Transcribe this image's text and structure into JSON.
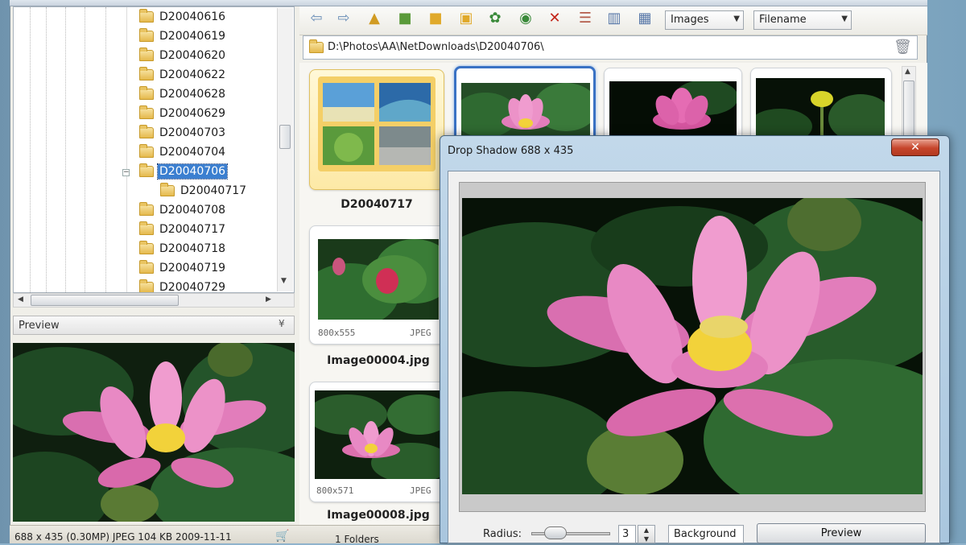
{
  "tree": {
    "items": [
      {
        "label": "D20040616"
      },
      {
        "label": "D20040619"
      },
      {
        "label": "D20040620"
      },
      {
        "label": "D20040622"
      },
      {
        "label": "D20040628"
      },
      {
        "label": "D20040629"
      },
      {
        "label": "D20040703"
      },
      {
        "label": "D20040704"
      },
      {
        "label": "D20040706",
        "selected": true
      },
      {
        "label": "D20040717",
        "child": true
      },
      {
        "label": "D20040708"
      },
      {
        "label": "D20040717"
      },
      {
        "label": "D20040718"
      },
      {
        "label": "D20040719"
      },
      {
        "label": "D20040729"
      }
    ]
  },
  "preview": {
    "title": "Preview"
  },
  "toolbar": {
    "filter_label": "Images",
    "sort_label": "Filename",
    "icons": [
      "back-arrow-icon",
      "forward-arrow-icon",
      "folder-up-icon",
      "folder-green-icon",
      "new-folder-icon",
      "open-folder-icon",
      "rotate-icon",
      "globe-refresh-icon",
      "delete-icon",
      "view-details-icon",
      "view-list-icon",
      "view-thumbnails-icon"
    ]
  },
  "address": {
    "path": "D:\\Photos\\AA\\NetDownloads\\D20040706\\"
  },
  "thumbnails": [
    {
      "caption": "D20040717",
      "kind": "folder"
    },
    {
      "caption": "",
      "kind": "image",
      "selected": true
    },
    {
      "caption": "",
      "kind": "image"
    },
    {
      "caption": "",
      "kind": "image"
    },
    {
      "caption": "Image00004.jpg",
      "dims": "800x555",
      "format": "JPEG"
    },
    {
      "caption": "Image00008.jpg",
      "dims": "800x571",
      "format": "JPEG"
    }
  ],
  "status": {
    "info": "688 x 435 (0.30MP)  JPEG  104 KB  2009-11-11",
    "folders": "1 Folders"
  },
  "dialog": {
    "title": "Drop Shadow   688 x 435",
    "close": "✕",
    "radius_label": "Radius:",
    "radius_value": "3",
    "background_label": "Background",
    "preview_label": "Preview"
  },
  "colors": {
    "selection": "#3b7fd0",
    "folder": "#e5b94c",
    "accent": "#3a72c4",
    "close_button": "#c6452b"
  }
}
